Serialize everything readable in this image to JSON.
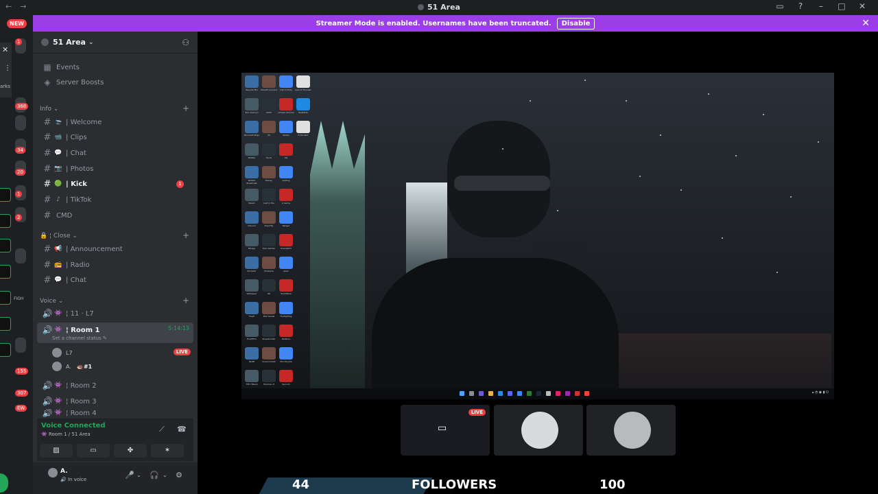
{
  "window": {
    "title": "51 Area",
    "nav_back": "←",
    "nav_forward": "→",
    "controls": [
      "▭",
      "?",
      "–",
      "□",
      "✕"
    ]
  },
  "banner": {
    "text": "Streamer Mode is enabled. Usernames have been truncated.",
    "button": "Disable",
    "close": "✕"
  },
  "rail": {
    "new_badge": "NEW",
    "badges": [
      "1",
      "368",
      "34",
      "20",
      "1",
      "2",
      "155",
      "307"
    ],
    "side_label": "arks",
    "clip_label": "FIGH",
    "new2": "EW"
  },
  "server": {
    "name": "51 Area",
    "chevron": "⌄"
  },
  "sidebar": {
    "events": "Events",
    "boosts": "Server Boosts",
    "cat_info": "Info",
    "cat_close": "Close",
    "cat_voice": "Voice",
    "channels_info": [
      {
        "emoji": "🛬",
        "label": "Welcome"
      },
      {
        "emoji": "📹",
        "label": "Clips"
      },
      {
        "emoji": "💬",
        "label": "Chat"
      },
      {
        "emoji": "📷",
        "label": "Photos"
      },
      {
        "emoji": "🟢",
        "label": "Kick",
        "badge": "1"
      },
      {
        "emoji": "",
        "label": "TikTok"
      },
      {
        "emoji": "",
        "label": "CMD"
      }
    ],
    "channels_close": [
      {
        "emoji": "📢",
        "label": "Announcement"
      },
      {
        "emoji": "",
        "label": "Radio"
      },
      {
        "emoji": "💬",
        "label": "Chat"
      }
    ],
    "voice_channels": [
      {
        "label": "11 · L7"
      },
      {
        "label": "Room 1",
        "timer": "5:14:13",
        "status": "Set a channel status"
      },
      {
        "label": "Room 2"
      },
      {
        "label": "Room 3"
      },
      {
        "label": "Room 4"
      }
    ],
    "voice_users": [
      {
        "name": "L7",
        "live": "LIVE"
      },
      {
        "name": "A.",
        "tag": "#1"
      }
    ]
  },
  "voice_panel": {
    "title": "Voice Connected",
    "subtitle": "Room 1 / 51 Area"
  },
  "user_panel": {
    "name": "A.",
    "status": "In voice"
  },
  "stage": {
    "thumb_live": "LIVE"
  },
  "overlay": {
    "count_left": "44",
    "label": "FOLLOWERS",
    "count_right": "100"
  },
  "desktop_icons": [
    "Recycle Bin",
    "Ubisoft Connect",
    "Call of Duty",
    "God of Thunder",
    "Tom Clancy's",
    "ASUS",
    "Google Chrome",
    "Hellblade",
    "Microsoft Edge",
    "VS",
    "Stellar",
    "Forticlient",
    "NVIDIA",
    "Forza",
    "Val",
    "Vigor",
    "NVIDIA Broadcast",
    "Money",
    "Getting",
    "",
    "Steam",
    "Lost in the",
    "A Game",
    "",
    "Discord",
    "Dead By",
    "Ranger",
    "",
    "Mirage",
    "Epic Games",
    "Overwatch",
    "",
    "Rockstar",
    "Schedule",
    "Apex",
    "",
    "Wallpaper",
    "R6",
    "RoadWare",
    "",
    "Fivefl",
    "RSX Global",
    "Firefighting",
    "",
    "FiveMFire",
    "Stupabuilder",
    "Relative",
    "",
    "RedM",
    "Supermarket",
    "Mini Royale",
    "",
    "THE FINALS",
    "Shadow of",
    "Sprunki",
    ""
  ]
}
